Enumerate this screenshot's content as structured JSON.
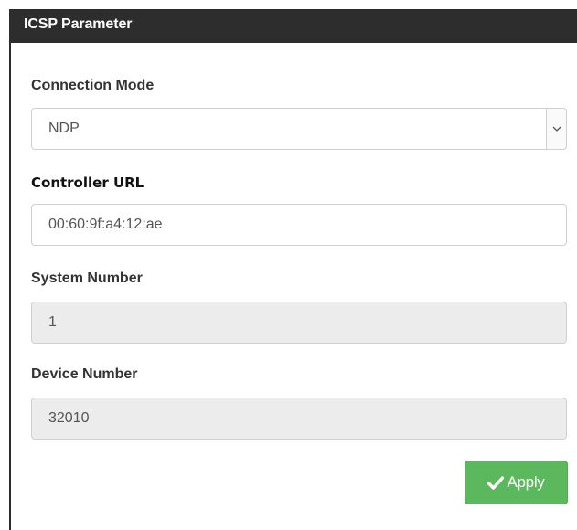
{
  "panel": {
    "title": "ICSP Parameter"
  },
  "connection_mode": {
    "label": "Connection Mode",
    "selected": "NDP"
  },
  "controller_url": {
    "label": "Controller URL",
    "value": "00:60:9f:a4:12:ae"
  },
  "system_number": {
    "label": "System Number",
    "value": "1"
  },
  "device_number": {
    "label": "Device Number",
    "value": "32010"
  },
  "apply_button": {
    "label": "Apply",
    "color": "#5cb85c"
  },
  "icons": {
    "dropdown": "chevron-down-icon",
    "apply": "checkmark-icon"
  }
}
